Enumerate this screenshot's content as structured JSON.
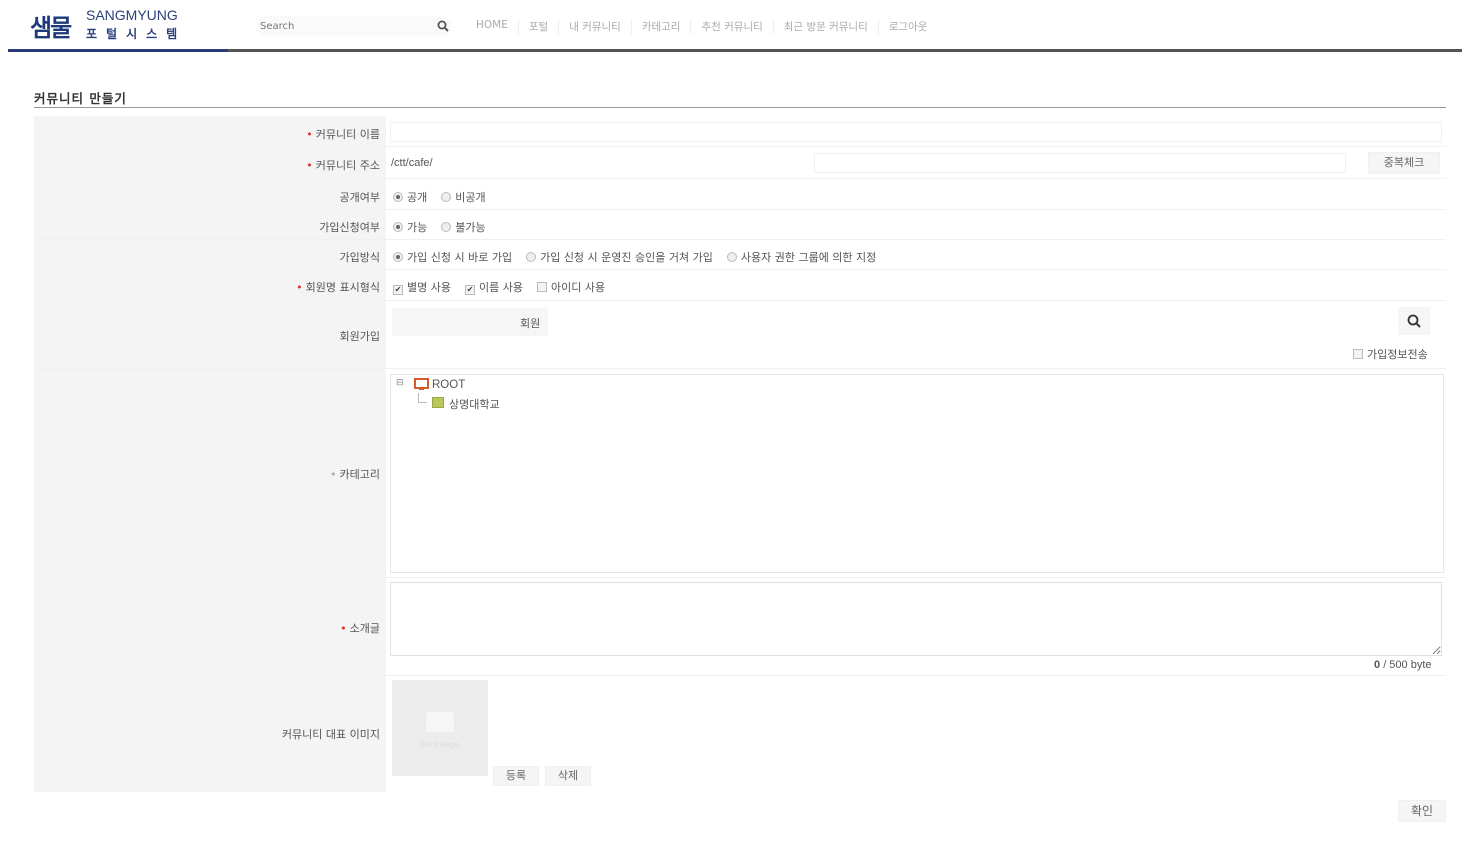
{
  "header": {
    "logo_mark": "샘물",
    "logo_en": "SANGMYUNG",
    "logo_ko": "포털시스템",
    "search_placeholder": "Search",
    "nav": [
      "HOME",
      "포털",
      "내 커뮤니티",
      "카테고리",
      "추천 커뮤니티",
      "최근 방문 커뮤니티",
      "로그아웃"
    ]
  },
  "page_title": "커뮤니티 만들기",
  "form": {
    "name": {
      "label": "커뮤니티 이름",
      "required": true,
      "value": ""
    },
    "address": {
      "label": "커뮤니티 주소",
      "required": true,
      "prefix": "/ctt/cafe/",
      "value": "",
      "check_button": "중복체크"
    },
    "visibility": {
      "label": "공개여부",
      "options": [
        "공개",
        "비공개"
      ],
      "selected": 0
    },
    "join_request": {
      "label": "가입신청여부",
      "options": [
        "가능",
        "불가능"
      ],
      "selected": 0
    },
    "join_method": {
      "label": "가입방식",
      "options": [
        "가입 신청 시 바로 가입",
        "가입 신청 시 운영진 승인을 거쳐 가입",
        "사용자 권한 그룹에 의한 지정"
      ],
      "selected": 0
    },
    "member_display": {
      "label": "회원명 표시형식",
      "required": true,
      "options": [
        {
          "label": "별명 사용",
          "checked": true
        },
        {
          "label": "이름 사용",
          "checked": true
        },
        {
          "label": "아이디 사용",
          "checked": false
        }
      ]
    },
    "member_join": {
      "label": "회원가입",
      "group_value": "회원",
      "search_icon": "search-icon",
      "transfer_label": "가입정보전송",
      "transfer_checked": false
    },
    "category": {
      "label": "카테고리",
      "required": true,
      "tree_root": "ROOT",
      "tree_child": "상명대학교"
    },
    "intro": {
      "label": "소개글",
      "required": true,
      "value": "",
      "byte_count": "0",
      "byte_limit": "/ 500 byte"
    },
    "image": {
      "label": "커뮤니티 대표 이미지",
      "placeholder_text": "No Image",
      "register_button": "등록",
      "delete_button": "삭제"
    }
  },
  "confirm_button": "확인",
  "colors": {
    "required": "#e0342b",
    "brand": "#2b3a78",
    "folder": "#d45a2a",
    "leaf": "#b9c65a"
  }
}
